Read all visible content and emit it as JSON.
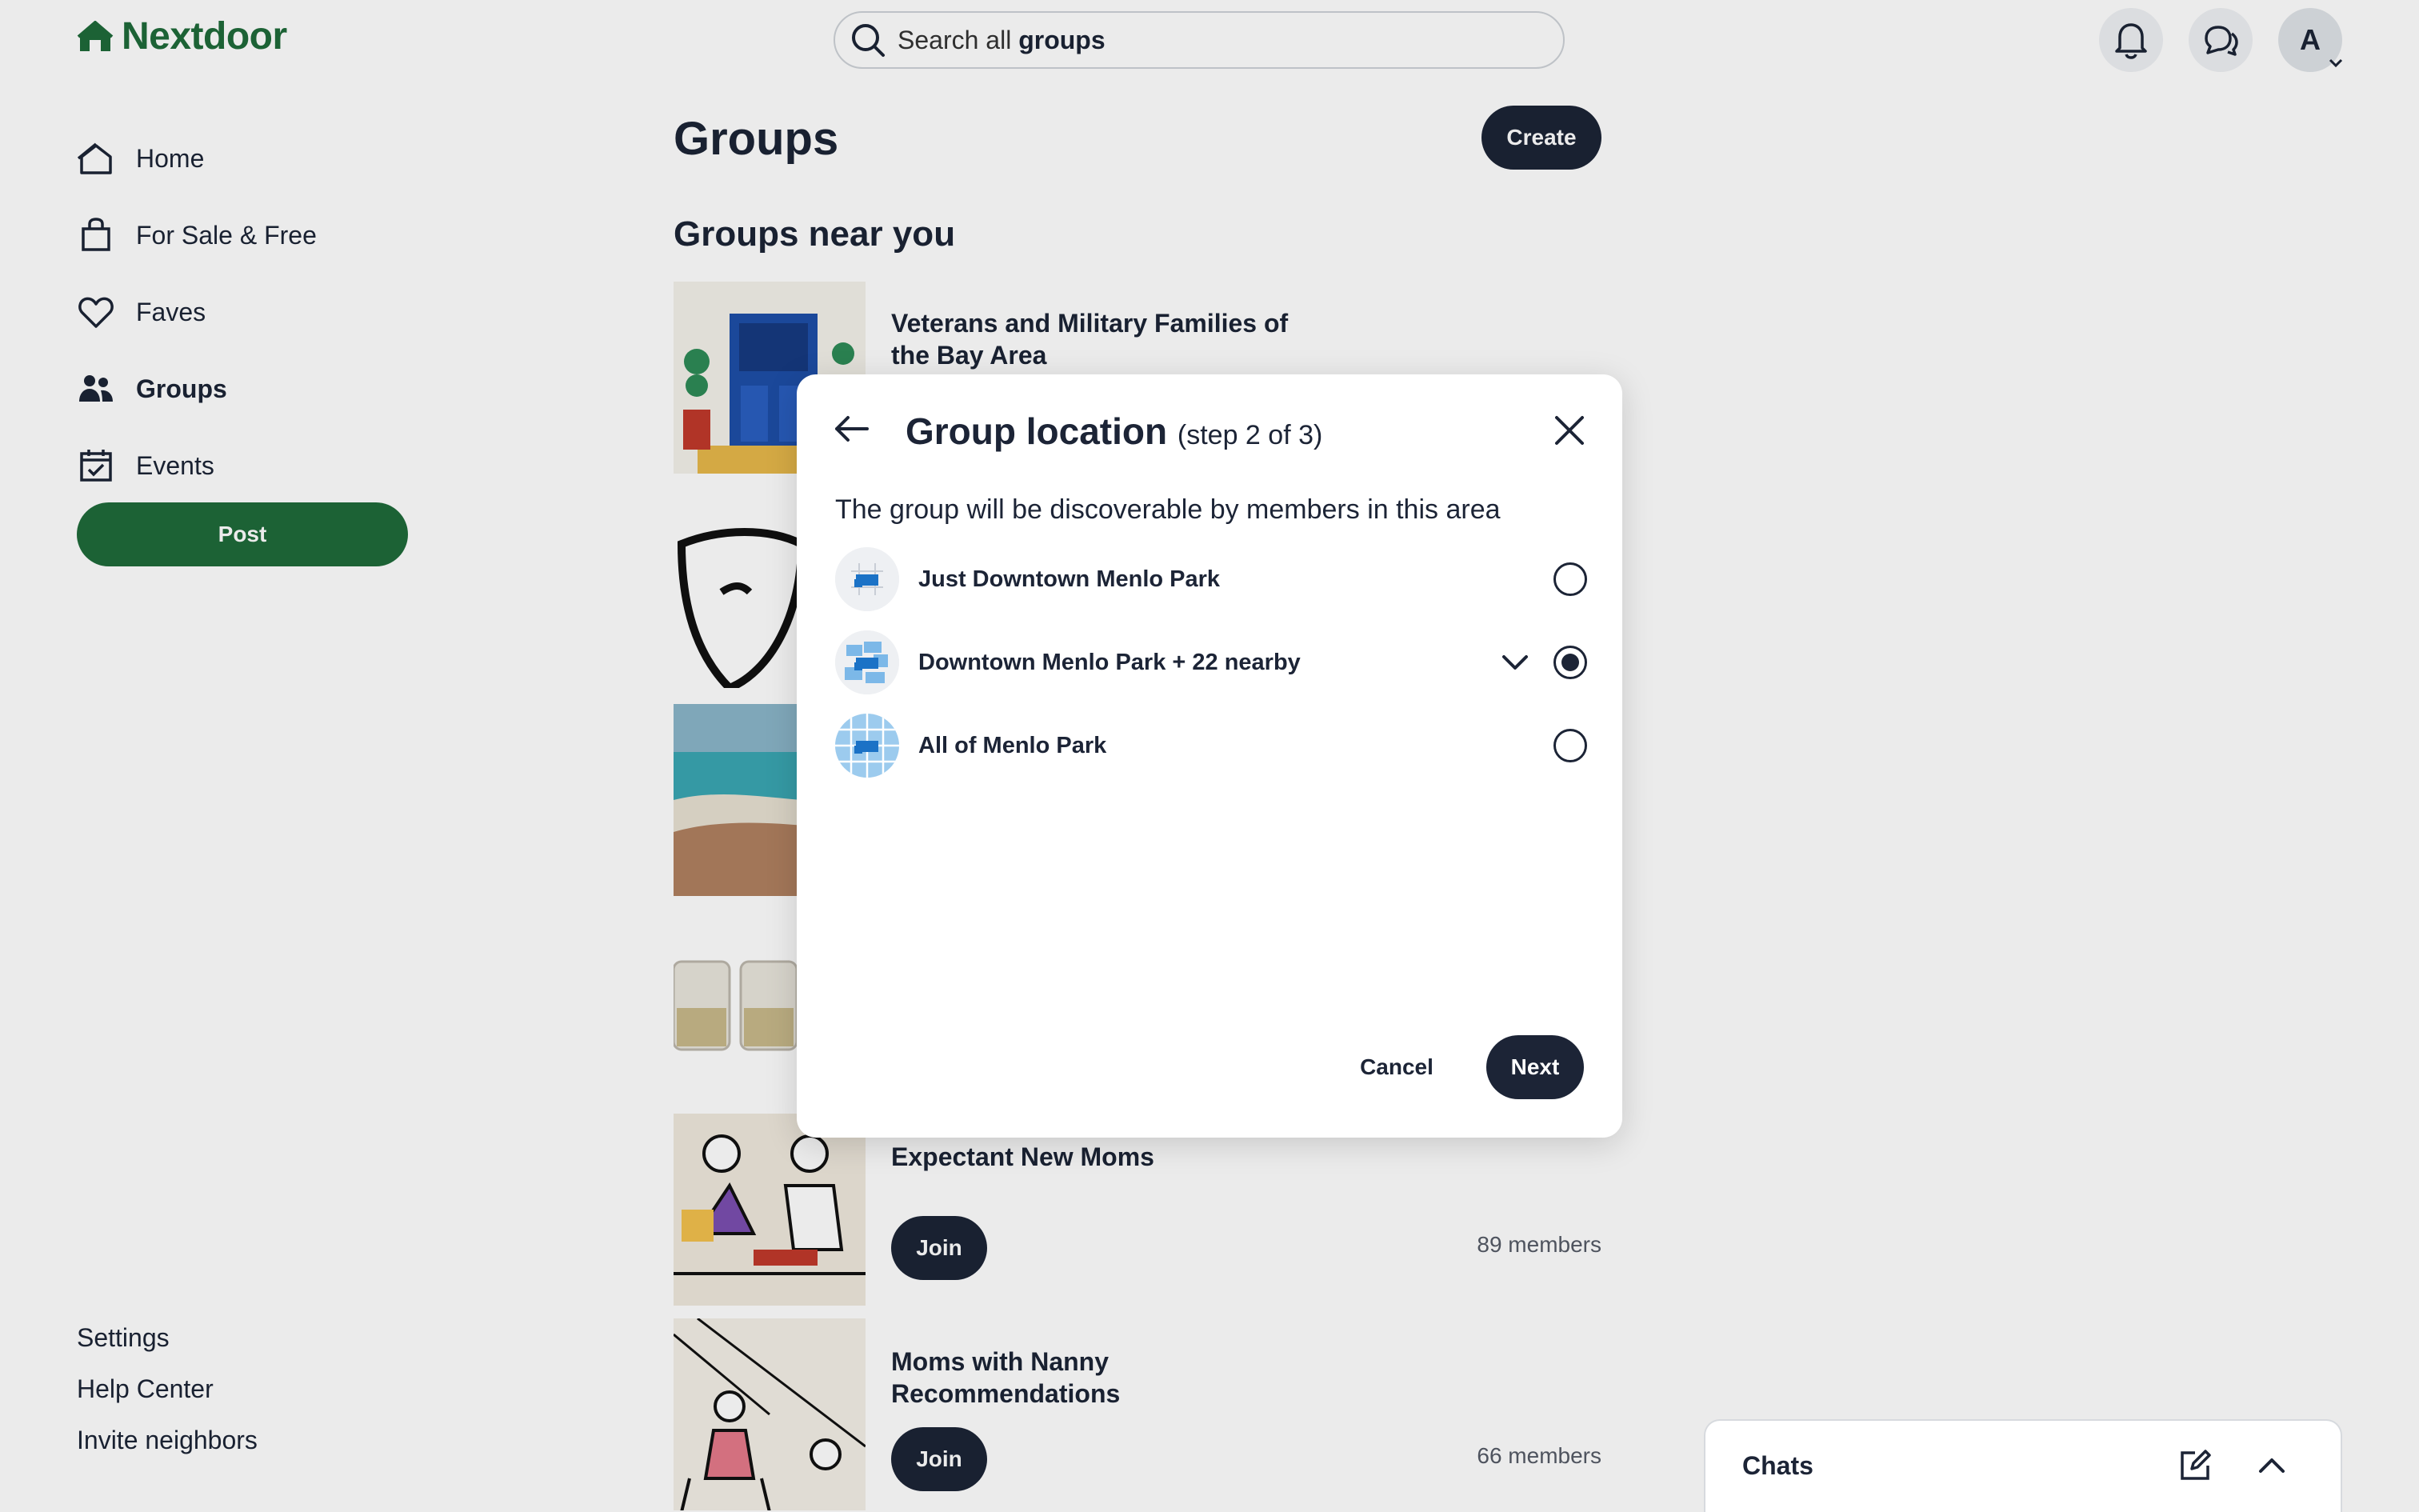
{
  "app": {
    "brand": "Nextdoor",
    "brand_color": "#1f6b3a",
    "accent": "#1c2436"
  },
  "search": {
    "prefix": "Search all ",
    "scope": "groups"
  },
  "header": {
    "avatar_initial": "A"
  },
  "sidebar": {
    "items": [
      {
        "label": "Home",
        "icon": "home-icon"
      },
      {
        "label": "For Sale & Free",
        "icon": "shopping-bag-icon"
      },
      {
        "label": "Faves",
        "icon": "heart-icon"
      },
      {
        "label": "Groups",
        "icon": "people-icon",
        "active": true
      },
      {
        "label": "Events",
        "icon": "calendar-icon"
      }
    ],
    "post_label": "Post",
    "footer": [
      "Settings",
      "Help Center",
      "Invite neighbors"
    ]
  },
  "main": {
    "title": "Groups",
    "create_label": "Create",
    "section_title": "Groups near you",
    "groups": [
      {
        "name": "Veterans and Military Families of the Bay Area"
      },
      {
        "name": "Expectant New Moms",
        "join_label": "Join",
        "members": "89 members"
      },
      {
        "name": "Moms with Nanny Recommendations",
        "join_label": "Join",
        "members": "66 members"
      }
    ]
  },
  "modal": {
    "title": "Group location",
    "step": "(step 2 of 3)",
    "description": "The group will be discoverable by members in this area",
    "options": [
      {
        "label": "Just Downtown Menlo Park",
        "selected": false
      },
      {
        "label": "Downtown Menlo Park + 22 nearby",
        "selected": true
      },
      {
        "label": "All of Menlo Park",
        "selected": false
      }
    ],
    "cancel_label": "Cancel",
    "next_label": "Next"
  },
  "chats": {
    "title": "Chats"
  }
}
